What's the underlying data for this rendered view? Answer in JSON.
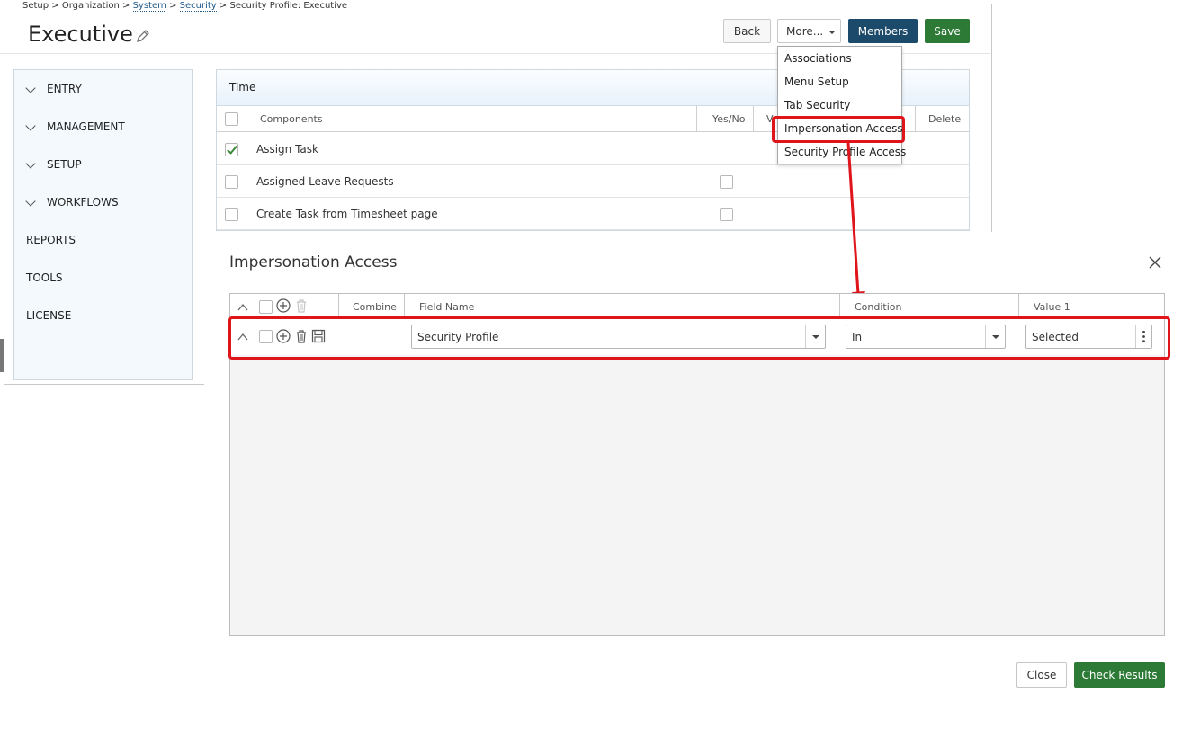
{
  "breadcrumb": {
    "setup": "Setup",
    "sep1": ">",
    "organization": "Organization",
    "sep2": ">",
    "system": "System",
    "sep3": ">",
    "security": "Security",
    "sep4": ">",
    "current": "Security Profile: Executive"
  },
  "page": {
    "title": "Executive"
  },
  "toolbar": {
    "back_label": "Back",
    "more_label": "More...",
    "members_label": "Members",
    "save_label": "Save"
  },
  "more_menu": {
    "items": [
      "Associations",
      "Menu Setup",
      "Tab Security",
      "Impersonation Access",
      "Security Profile Access"
    ]
  },
  "sidebar": {
    "items": [
      {
        "label": "ENTRY",
        "expandable": true
      },
      {
        "label": "MANAGEMENT",
        "expandable": true
      },
      {
        "label": "SETUP",
        "expandable": true
      },
      {
        "label": "WORKFLOWS",
        "expandable": true
      },
      {
        "label": "REPORTS",
        "expandable": false
      },
      {
        "label": "TOOLS",
        "expandable": false
      },
      {
        "label": "LICENSE",
        "expandable": false
      }
    ]
  },
  "time_panel": {
    "title": "Time",
    "columns": {
      "components": "Components",
      "yesno": "Yes/No",
      "col3": "V",
      "delete": "Delete"
    },
    "rows": [
      {
        "label": "Assign Task",
        "selected": true
      },
      {
        "label": "Assigned Leave Requests",
        "selected": false
      },
      {
        "label": "Create Task from Timesheet page",
        "selected": false
      }
    ]
  },
  "dialog": {
    "title": "Impersonation Access",
    "columns": {
      "combine": "Combine",
      "field_name": "Field Name",
      "condition": "Condition",
      "value1": "Value 1"
    },
    "row": {
      "field_name": "Security Profile",
      "condition": "In",
      "value1": "Selected"
    },
    "close_label": "Close",
    "check_label": "Check Results"
  },
  "colors": {
    "members_bg": "#1b4a6b",
    "save_bg": "#2c7a35",
    "highlight": "#e0141b"
  }
}
